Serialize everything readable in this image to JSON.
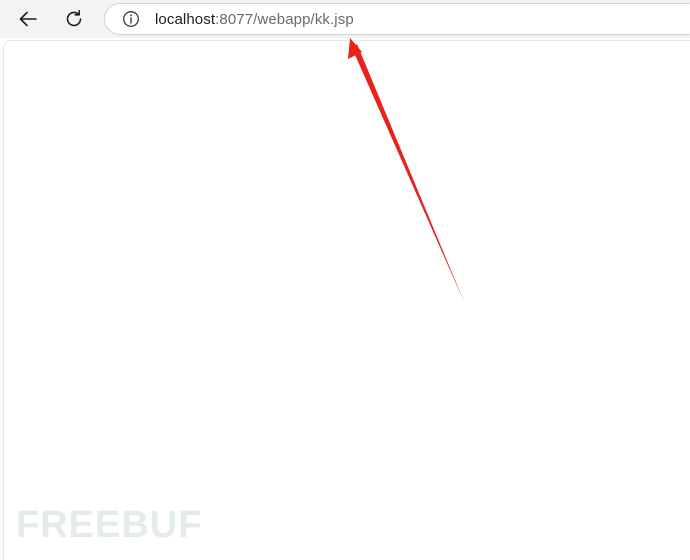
{
  "browser": {
    "address_bar": {
      "host": "localhost",
      "rest": ":8077/webapp/kk.jsp"
    }
  },
  "icons": {
    "back": "arrow-left-icon",
    "reload": "reload-icon",
    "info": "info-icon"
  },
  "annotation": {
    "arrow_color": "#e8211a"
  },
  "watermark": {
    "text": "FREEBUF"
  }
}
